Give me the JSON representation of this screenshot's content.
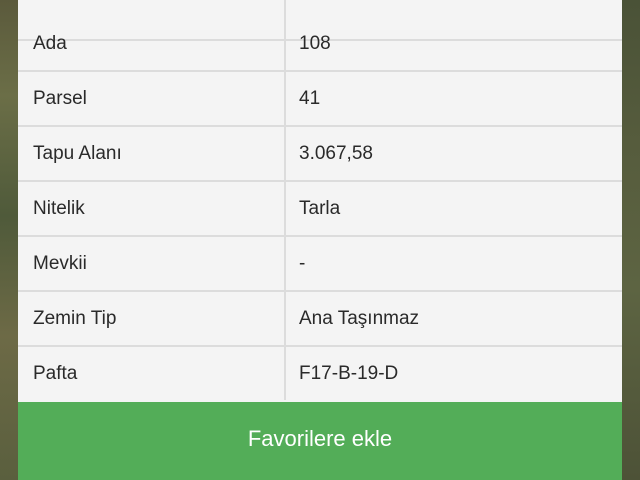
{
  "details": {
    "rows": [
      {
        "label": "",
        "value": ""
      },
      {
        "label": "Ada",
        "value": "108"
      },
      {
        "label": "Parsel",
        "value": "41"
      },
      {
        "label": "Tapu Alanı",
        "value": "3.067,58"
      },
      {
        "label": "Nitelik",
        "value": "Tarla"
      },
      {
        "label": "Mevkii",
        "value": "-"
      },
      {
        "label": "Zemin Tip",
        "value": "Ana Taşınmaz"
      },
      {
        "label": "Pafta",
        "value": "F17-B-19-D"
      }
    ]
  },
  "actions": {
    "favorite_label": "Favorilere ekle"
  },
  "colors": {
    "button_green": "#53ad58",
    "table_background": "#f4f4f4",
    "divider": "#dcdcdc"
  }
}
